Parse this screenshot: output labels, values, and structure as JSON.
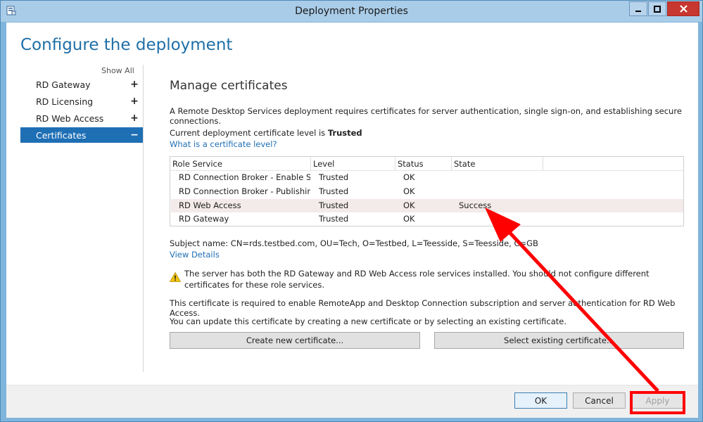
{
  "window": {
    "title": "Deployment Properties"
  },
  "page_title": "Configure the deployment",
  "nav": {
    "show_all": "Show All",
    "items": [
      {
        "label": "RD Gateway",
        "sign": "+"
      },
      {
        "label": "RD Licensing",
        "sign": "+"
      },
      {
        "label": "RD Web Access",
        "sign": "+"
      },
      {
        "label": "Certificates",
        "sign": "−"
      }
    ]
  },
  "section": {
    "title": "Manage certificates",
    "intro": "A Remote Desktop Services deployment requires certificates for server authentication, single sign-on, and establishing secure connections.",
    "level_prefix": "Current deployment certificate level is ",
    "level_value": "Trusted",
    "level_link": "What is a certificate level?"
  },
  "table": {
    "headers": [
      "Role Service",
      "Level",
      "Status",
      "State"
    ],
    "rows": [
      {
        "role": "RD Connection Broker - Enable Single Sign On",
        "level": "Trusted",
        "status": "OK",
        "state": ""
      },
      {
        "role": "RD Connection Broker - Publishing",
        "level": "Trusted",
        "status": "OK",
        "state": ""
      },
      {
        "role": "RD Web Access",
        "level": "Trusted",
        "status": "OK",
        "state": "Success"
      },
      {
        "role": "RD Gateway",
        "level": "Trusted",
        "status": "OK",
        "state": ""
      }
    ]
  },
  "details": {
    "subject": "Subject name: CN=rds.testbed.com, OU=Tech, O=Testbed, L=Teesside, S=Teesside, C=GB",
    "view_details": "View Details",
    "warning": "The server has both the RD Gateway and RD Web Access role services installed. You should not configure different certificates for these role services.",
    "required_note": "This certificate is required to enable RemoteApp and Desktop Connection subscription and server authentication for RD Web Access.",
    "update_note": "You can update this certificate by creating a new certificate or by selecting an existing certificate."
  },
  "buttons": {
    "create_new": "Create new certificate...",
    "select_existing": "Select existing certificate...",
    "ok": "OK",
    "cancel": "Cancel",
    "apply": "Apply"
  },
  "colors": {
    "accent": "#1f6fb5",
    "title_blue": "#1f6fa8",
    "annotation_red": "#ff0000"
  }
}
